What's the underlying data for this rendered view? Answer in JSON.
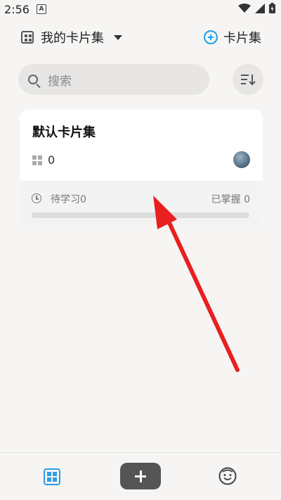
{
  "status_bar": {
    "time": "2:56",
    "notification_glyph": "A"
  },
  "header": {
    "collection_title": "我的卡片集",
    "add_label": "卡片集"
  },
  "search": {
    "placeholder": "搜索"
  },
  "card": {
    "title": "默认卡片集",
    "card_count": "0",
    "pending_label": "待学习0",
    "mastered_label": "已掌握 0",
    "progress_fraction": 0
  },
  "colors": {
    "accent": "#1ea1e6",
    "annotation_arrow": "#e8201f",
    "add_button": "#555555"
  },
  "icons": [
    "grid-icon",
    "caret-down-icon",
    "plus-circle-icon",
    "search-icon",
    "sort-icon",
    "deck-icon",
    "avatar",
    "clock-icon",
    "home-grid-icon",
    "add-icon",
    "face-icon"
  ]
}
